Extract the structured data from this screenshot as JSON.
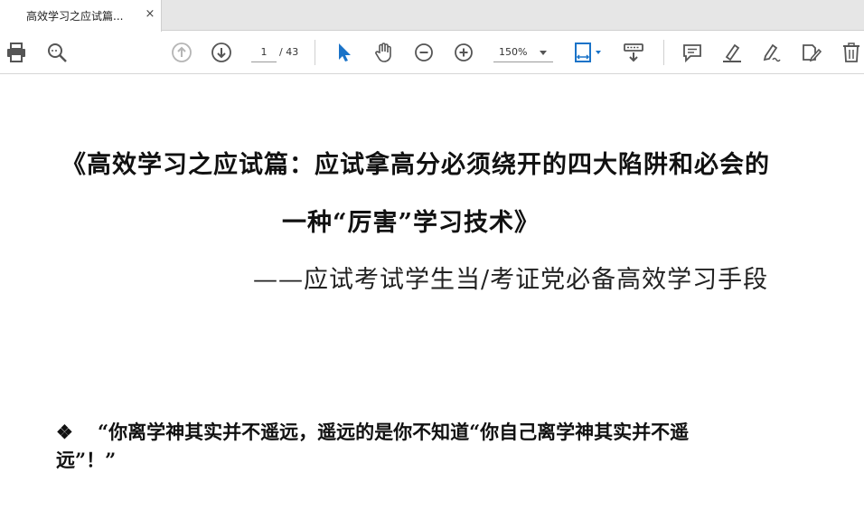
{
  "tab": {
    "title": "高效学习之应试篇...",
    "close_glyph": "×"
  },
  "toolbar": {
    "icons": [
      "printer-icon",
      "zoom-search-icon",
      "page-up-icon",
      "page-down-icon",
      "select-cursor-icon",
      "hand-tool-icon",
      "zoom-out-icon",
      "zoom-in-icon",
      "fit-page-icon",
      "scroll-mode-icon",
      "comment-icon",
      "highlight-icon",
      "sign-icon",
      "fill-sign-icon",
      "delete-icon"
    ],
    "current_page": "1",
    "total_pages": "/ 43",
    "zoom": "150%",
    "accent_color": "#1a73c8"
  },
  "document": {
    "title_line1": "《高效学习之应试篇：应试拿高分必须绕开的四大陷阱和必会的",
    "title_line2": "一种“厉害”学习技术》",
    "subtitle": "——应试考试学生当/考证党必备高效学习手段",
    "bullet_glyph": "❖",
    "quote_line1": "“你离学神其实并不遥远，遥远的是你不知道“你自己离学神其实并不遥",
    "quote_line2": "远”！”"
  }
}
